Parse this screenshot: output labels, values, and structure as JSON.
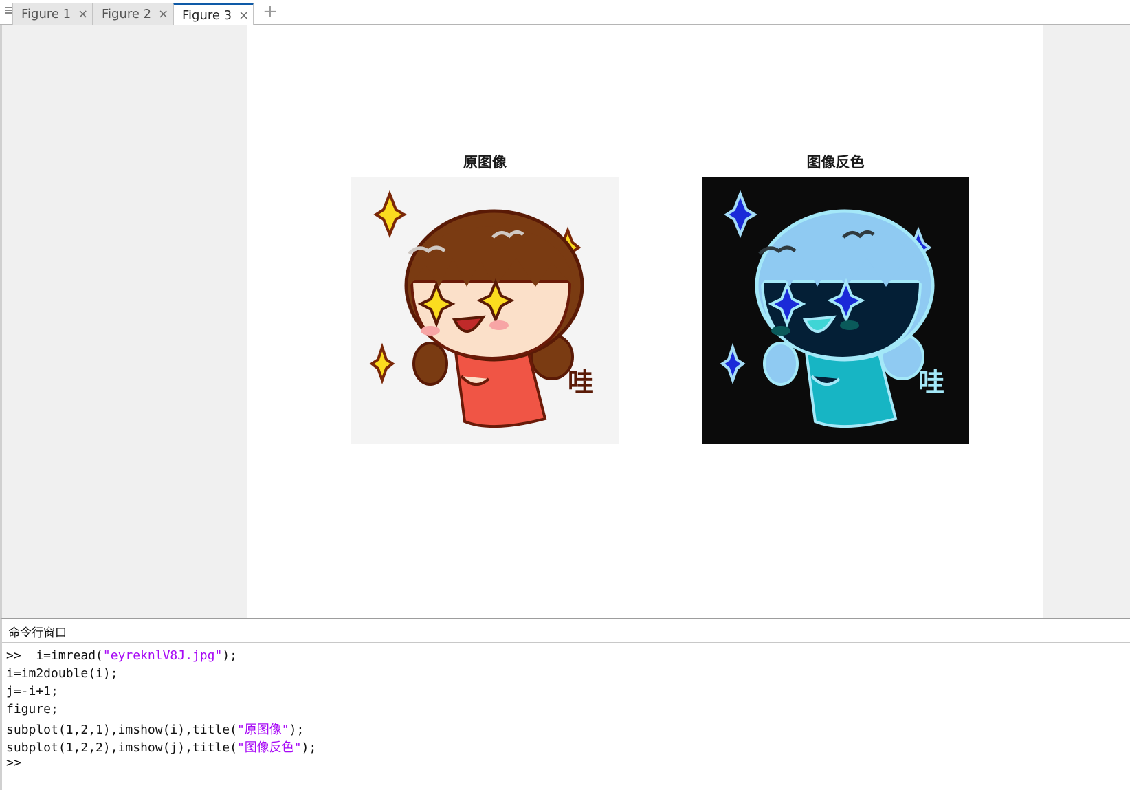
{
  "tabs": [
    {
      "label": "Figure 1",
      "active": false
    },
    {
      "label": "Figure 2",
      "active": false
    },
    {
      "label": "Figure 3",
      "active": true
    }
  ],
  "tab_close_glyph": "×",
  "tab_add_glyph": "+",
  "figure": {
    "subplots": [
      {
        "title": "原图像",
        "image": "cartoon girl with sparkles, original colours",
        "badge_text": "哇"
      },
      {
        "title": "图像反色",
        "image": "same cartoon girl, colour-inverted on black",
        "badge_text": "哇"
      }
    ],
    "colors": {
      "original_background": "#f4f4f4",
      "inverted_background": "#0b0b0b",
      "hair_original": "#7a3b12",
      "hair_inverted": "#8fcaf2"
    }
  },
  "command_window": {
    "title": "命令行窗口",
    "lines": [
      {
        "code": ">>  i=imread(",
        "string": "\"eyreknlV8J.jpg\"",
        "rest": ");"
      },
      {
        "code": "i=im2double(i);",
        "string": "",
        "rest": ""
      },
      {
        "code": "j=-i+1;",
        "string": "",
        "rest": ""
      },
      {
        "code": "figure;",
        "string": "",
        "rest": ""
      },
      {
        "code": "subplot(1,2,1),imshow(i),title(",
        "string": "\"原图像\"",
        "rest": ");"
      },
      {
        "code": "subplot(1,2,2),imshow(j),title(",
        "string": "\"图像反色\"",
        "rest": ");"
      },
      {
        "code": ">>",
        "string": "",
        "rest": ""
      }
    ],
    "colors": {
      "string": "#a709f5"
    }
  }
}
